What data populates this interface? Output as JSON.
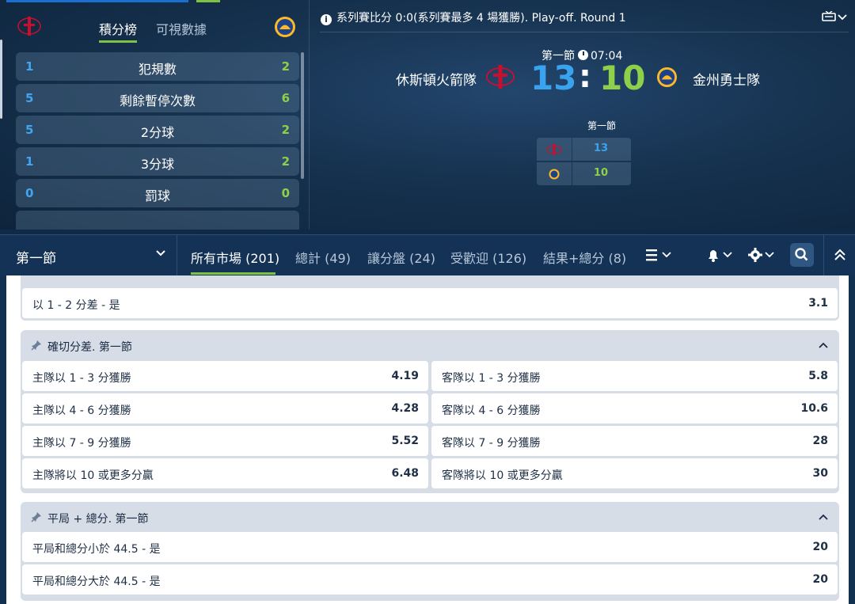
{
  "stats": {
    "tabs": [
      "積分榜",
      "可視數據"
    ],
    "rows": [
      {
        "home": "1",
        "label": "犯規數",
        "away": "2"
      },
      {
        "home": "5",
        "label": "剩餘暫停次數",
        "away": "6"
      },
      {
        "home": "5",
        "label": "2分球",
        "away": "2"
      },
      {
        "home": "1",
        "label": "3分球",
        "away": "2"
      },
      {
        "home": "0",
        "label": "罰球",
        "away": "0"
      }
    ]
  },
  "match": {
    "info": "系列賽比分 0:0(系列賽最多 4 場獲勝). Play-off. Round 1",
    "period": "第一節",
    "clock": "07:04",
    "home_team": "休斯頓火箭隊",
    "away_team": "金州勇士隊",
    "home_score": "13",
    "colon": ":",
    "away_score": "10",
    "mini_title": "第一節",
    "mini_home": "13",
    "mini_away": "10"
  },
  "nav": {
    "period_select": "第一節",
    "tabs": [
      "所有市場 (201)",
      "總計 (49)",
      "讓分盤 (24)",
      "受歡迎 (126)",
      "結果+總分 (8)"
    ]
  },
  "markets": {
    "partial_row": {
      "name": "以 1 - 2 分差 - 是",
      "odd": "3.1"
    },
    "exact_margin": {
      "title": "確切分差. 第一節",
      "rows": [
        [
          {
            "name": "主隊以 1 - 3 分獲勝",
            "odd": "4.19"
          },
          {
            "name": "客隊以 1 - 3 分獲勝",
            "odd": "5.8"
          }
        ],
        [
          {
            "name": "主隊以 4 - 6 分獲勝",
            "odd": "4.28"
          },
          {
            "name": "客隊以 4 - 6 分獲勝",
            "odd": "10.6"
          }
        ],
        [
          {
            "name": "主隊以 7 - 9 分獲勝",
            "odd": "5.52"
          },
          {
            "name": "客隊以 7 - 9 分獲勝",
            "odd": "28"
          }
        ],
        [
          {
            "name": "主隊將以 10 或更多分贏",
            "odd": "6.48"
          },
          {
            "name": "客隊將以 10 或更多分贏",
            "odd": "30"
          }
        ]
      ]
    },
    "draw_total": {
      "title": "平局 + 總分. 第一節",
      "rows": [
        {
          "name": "平局和總分小於 44.5 - 是",
          "odd": "20"
        },
        {
          "name": "平局和總分大於 44.5 - 是",
          "odd": "20"
        }
      ]
    }
  },
  "colors": {
    "home": "#3aa3f0",
    "away": "#8ed04a",
    "accent": "#7dc242"
  }
}
